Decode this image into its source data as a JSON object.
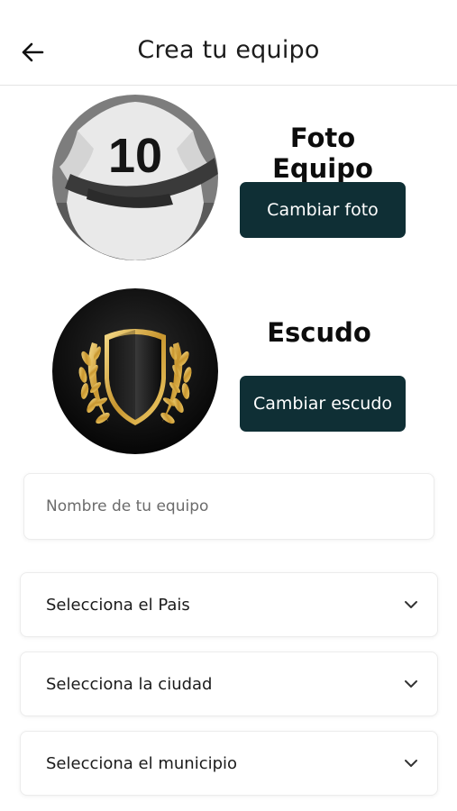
{
  "header": {
    "title": "Crea tu equipo",
    "back_icon": "arrow-left-icon"
  },
  "team_photo": {
    "label": "Foto Equipo",
    "button_label": "Cambiar foto",
    "jersey_number": "10"
  },
  "crest": {
    "label": "Escudo",
    "button_label": "Cambiar escudo"
  },
  "form": {
    "team_name": {
      "placeholder": "Nombre de tu equipo",
      "value": ""
    },
    "selects": [
      {
        "label": "Selecciona el Pais",
        "icon": "chevron-down-icon"
      },
      {
        "label": "Selecciona la ciudad",
        "icon": "chevron-down-icon"
      },
      {
        "label": "Selecciona el municipio",
        "icon": "chevron-down-icon"
      }
    ]
  },
  "colors": {
    "button_bg": "#0f2f35",
    "button_text": "#ffffff",
    "gold": "#d4a84a"
  }
}
